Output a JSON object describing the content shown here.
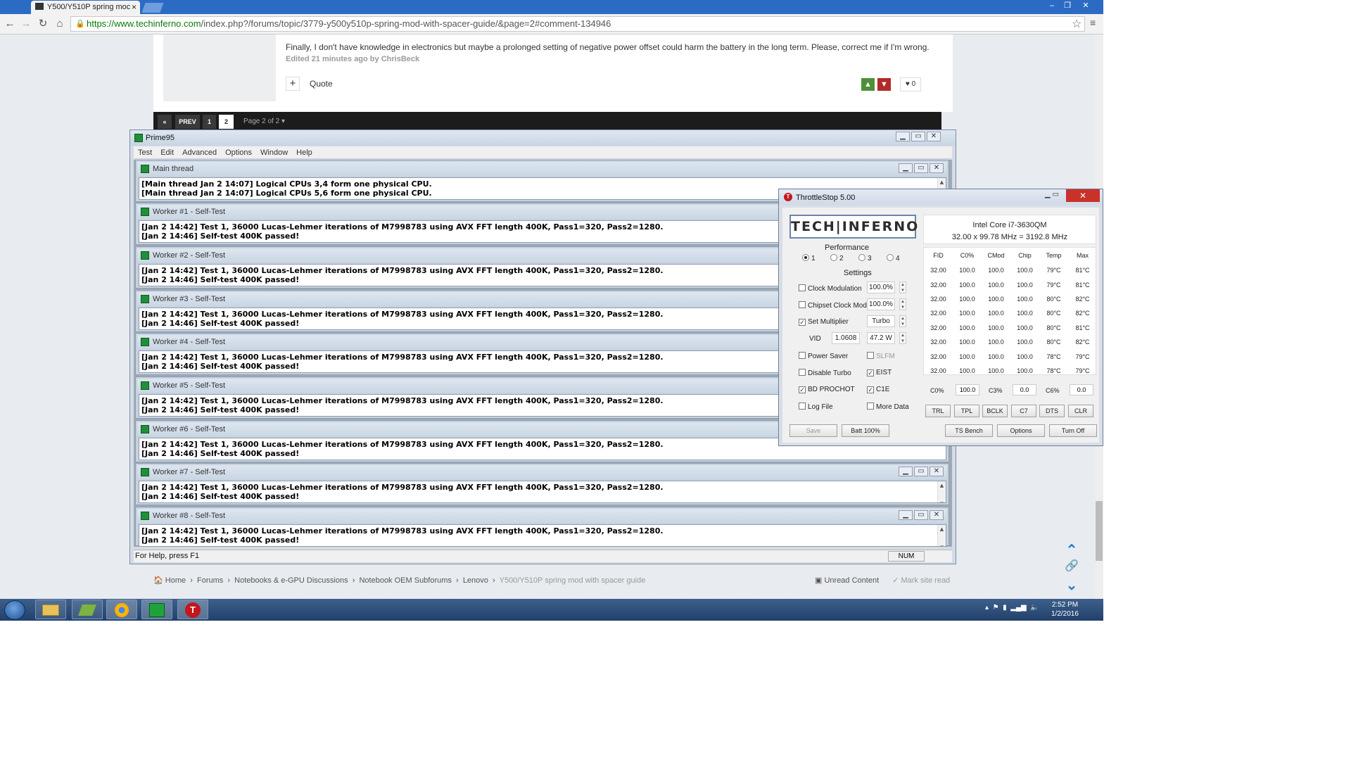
{
  "browser": {
    "tab_title": "Y500/Y510P spring moc",
    "url_host": "https://www.techinferno.com",
    "url_path": "/index.php?/forums/topic/3779-y500y510p-spring-mod-with-spacer-guide/&page=2#comment-134946"
  },
  "post": {
    "text": "Finally, I don't have knowledge in electronics but maybe a prolonged setting of negative power offset could harm the battery in the long term. Please, correct me if I'm wrong.",
    "edited": "Edited 21 minutes ago by ChrisBeck",
    "quote_label": "Quote",
    "likes": "0"
  },
  "pagination": {
    "prev": "PREV",
    "pages": [
      "1",
      "2"
    ],
    "current": "2",
    "label": "Page 2 of 2"
  },
  "breadcrumb": {
    "items": [
      "Home",
      "Forums",
      "Notebooks & e-GPU Discussions",
      "Notebook OEM Subforums",
      "Lenovo",
      "Y500/Y510P spring mod with spacer guide"
    ],
    "unread": "Unread Content",
    "mark_read": "Mark site read"
  },
  "prime95": {
    "title": "Prime95",
    "menu": [
      "Test",
      "Edit",
      "Advanced",
      "Options",
      "Window",
      "Help"
    ],
    "status": "For Help, press F1",
    "num": "NUM",
    "windows": [
      {
        "name": "Main thread",
        "lines": [
          "[Main thread Jan 2 14:07] Logical CPUs 3,4 form one physical CPU.",
          "[Main thread Jan 2 14:07] Logical CPUs 5,6 form one physical CPU."
        ]
      },
      {
        "name": "Worker #1 - Self-Test",
        "lines": [
          "[Jan 2 14:42] Test 1, 36000 Lucas-Lehmer iterations of M7998783 using AVX FFT length 400K, Pass1=320, Pass2=1280.",
          "[Jan 2 14:46] Self-test 400K passed!"
        ]
      },
      {
        "name": "Worker #2 - Self-Test",
        "lines": [
          "[Jan 2 14:42] Test 1, 36000 Lucas-Lehmer iterations of M7998783 using AVX FFT length 400K, Pass1=320, Pass2=1280.",
          "[Jan 2 14:46] Self-test 400K passed!"
        ]
      },
      {
        "name": "Worker #3 - Self-Test",
        "lines": [
          "[Jan 2 14:42] Test 1, 36000 Lucas-Lehmer iterations of M7998783 using AVX FFT length 400K, Pass1=320, Pass2=1280.",
          "[Jan 2 14:46] Self-test 400K passed!"
        ]
      },
      {
        "name": "Worker #4 - Self-Test",
        "lines": [
          "[Jan 2 14:42] Test 1, 36000 Lucas-Lehmer iterations of M7998783 using AVX FFT length 400K, Pass1=320, Pass2=1280.",
          "[Jan 2 14:46] Self-test 400K passed!"
        ]
      },
      {
        "name": "Worker #5 - Self-Test",
        "lines": [
          "[Jan 2 14:42] Test 1, 36000 Lucas-Lehmer iterations of M7998783 using AVX FFT length 400K, Pass1=320, Pass2=1280.",
          "[Jan 2 14:46] Self-test 400K passed!"
        ]
      },
      {
        "name": "Worker #6 - Self-Test",
        "lines": [
          "[Jan 2 14:42] Test 1, 36000 Lucas-Lehmer iterations of M7998783 using AVX FFT length 400K, Pass1=320, Pass2=1280.",
          "[Jan 2 14:46] Self-test 400K passed!"
        ]
      },
      {
        "name": "Worker #7 - Self-Test",
        "lines": [
          "[Jan 2 14:42] Test 1, 36000 Lucas-Lehmer iterations of M7998783 using AVX FFT length 400K, Pass1=320, Pass2=1280.",
          "[Jan 2 14:46] Self-test 400K passed!"
        ]
      },
      {
        "name": "Worker #8 - Self-Test",
        "lines": [
          "[Jan 2 14:42] Test 1, 36000 Lucas-Lehmer iterations of M7998783 using AVX FFT length 400K, Pass1=320, Pass2=1280.",
          "[Jan 2 14:46] Self-test 400K passed!"
        ]
      }
    ]
  },
  "throttlestop": {
    "title": "ThrottleStop 5.00",
    "logo": "TECH|INFERNO",
    "cpu_name": "Intel Core i7-3630QM",
    "cpu_speed": "32.00 x 99.78 MHz = 3192.8 MHz",
    "performance_label": "Performance",
    "profiles": [
      "1",
      "2",
      "3",
      "4"
    ],
    "settings_label": "Settings",
    "clock_modulation": {
      "label": "Clock Modulation",
      "checked": false,
      "value": "100.0%"
    },
    "chipset_clock_mod": {
      "label": "Chipset Clock Mod",
      "checked": false,
      "value": "100.0%"
    },
    "set_multiplier": {
      "label": "Set Multiplier",
      "checked": true,
      "value": "Turbo"
    },
    "vid_label": "VID",
    "vid": "1.0608",
    "power": "47.2 W",
    "options_left": [
      {
        "label": "Power Saver",
        "checked": false
      },
      {
        "label": "Disable Turbo",
        "checked": false
      },
      {
        "label": "BD PROCHOT",
        "checked": true
      },
      {
        "label": "Log File",
        "checked": false
      }
    ],
    "options_right": [
      {
        "label": "SLFM",
        "checked": false,
        "disabled": true
      },
      {
        "label": "EIST",
        "checked": true
      },
      {
        "label": "C1E",
        "checked": true
      },
      {
        "label": "More Data",
        "checked": false
      }
    ],
    "table_headers": [
      "FID",
      "C0%",
      "CMod",
      "Chip",
      "Temp",
      "Max"
    ],
    "rows": [
      [
        "32.00",
        "100.0",
        "100.0",
        "100.0",
        "79°C",
        "81°C"
      ],
      [
        "32.00",
        "100.0",
        "100.0",
        "100.0",
        "79°C",
        "81°C"
      ],
      [
        "32.00",
        "100.0",
        "100.0",
        "100.0",
        "80°C",
        "82°C"
      ],
      [
        "32.00",
        "100.0",
        "100.0",
        "100.0",
        "80°C",
        "82°C"
      ],
      [
        "32.00",
        "100.0",
        "100.0",
        "100.0",
        "80°C",
        "81°C"
      ],
      [
        "32.00",
        "100.0",
        "100.0",
        "100.0",
        "80°C",
        "82°C"
      ],
      [
        "32.00",
        "100.0",
        "100.0",
        "100.0",
        "78°C",
        "79°C"
      ],
      [
        "32.00",
        "100.0",
        "100.0",
        "100.0",
        "78°C",
        "79°C"
      ]
    ],
    "cstates": [
      {
        "label": "C0%",
        "value": "100.0"
      },
      {
        "label": "C3%",
        "value": "0.0"
      },
      {
        "label": "C6%",
        "value": "0.0"
      }
    ],
    "buttons_row": [
      "TRL",
      "TPL",
      "BCLK",
      "C7",
      "DTS",
      "CLR"
    ],
    "save": "Save",
    "batt": "Batt 100%",
    "ts_bench": "TS Bench",
    "options": "Options",
    "turn_off": "Turn Off"
  },
  "taskbar": {
    "time": "2:52 PM",
    "date": "1/2/2016"
  }
}
